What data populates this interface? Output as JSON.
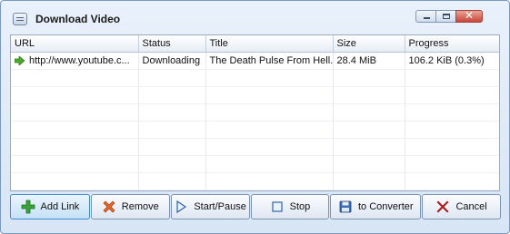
{
  "window": {
    "title": "Download Video"
  },
  "table": {
    "columns": [
      "URL",
      "Status",
      "Title",
      "Size",
      "Progress"
    ],
    "rows": [
      {
        "url": "http://www.youtube.c...",
        "status": "Downloading",
        "title": "The Death Pulse From Hell.",
        "size": "28.4 MiB",
        "progress": "106.2 KiB (0.3%)"
      }
    ]
  },
  "toolbar": {
    "add_link": "Add Link",
    "remove": "Remove",
    "start_pause": "Start/Pause",
    "stop": "Stop",
    "to_converter": "to Converter",
    "cancel": "Cancel"
  },
  "colors": {
    "accent": "#3d8bd0",
    "add": "#3aa33a",
    "remove": "#e06020",
    "cancel": "#cc2020"
  }
}
